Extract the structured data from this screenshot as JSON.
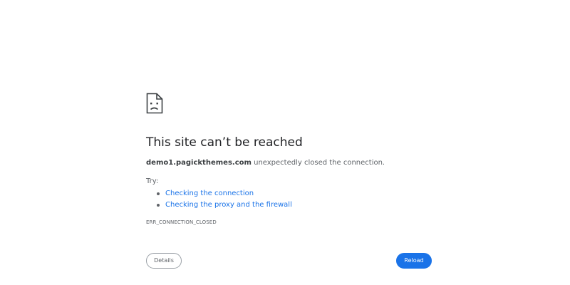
{
  "error": {
    "icon": "sad-page-icon",
    "title": "This site can’t be reached",
    "host": "demo1.pagickthemes.com",
    "message_suffix": " unexpectedly closed the connection.",
    "try_label": "Try:",
    "suggestions": [
      "Checking the connection",
      "Checking the proxy and the firewall"
    ],
    "code": "ERR_CONNECTION_CLOSED"
  },
  "buttons": {
    "details_label": "Details",
    "reload_label": "Reload"
  },
  "colors": {
    "accent": "#1a73e8",
    "text_primary": "#202124",
    "text_secondary": "#5f6368"
  }
}
